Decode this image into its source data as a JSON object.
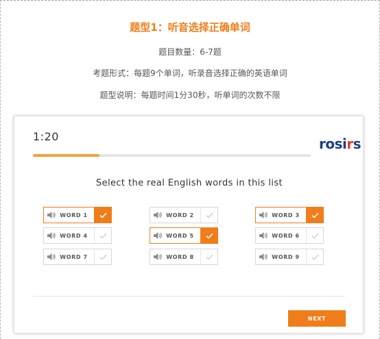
{
  "intro": {
    "title": "题型1：听音选择正确单词",
    "count": "题目数量：6-7题",
    "format": "考题形式：每题9个单词，听录音选择正确的英语单词",
    "description": "题型说明：每题时间1分30秒，听单词的次数不限"
  },
  "quiz": {
    "timer": "1:20",
    "logo_text": "rosi",
    "logo_swoosh": "r",
    "logo_tail": "s",
    "progress": 0.24,
    "instruction": "Select the real English words in this list",
    "words": [
      {
        "label": "WORD 1",
        "selected": true
      },
      {
        "label": "WORD 2",
        "selected": false
      },
      {
        "label": "WORD 3",
        "selected": true
      },
      {
        "label": "WORD 4",
        "selected": false
      },
      {
        "label": "WORD 5",
        "selected": true
      },
      {
        "label": "WORD 6",
        "selected": false
      },
      {
        "label": "WORD 7",
        "selected": false
      },
      {
        "label": "WORD 8",
        "selected": false
      },
      {
        "label": "WORD 9",
        "selected": false
      }
    ],
    "next_label": "NEXT"
  },
  "colors": {
    "accent": "#f07d19",
    "progress": "#f5a13a",
    "logo_blue": "#1b3f84",
    "logo_red": "#e23c2c"
  },
  "icons": {
    "speaker": "speaker-icon",
    "check": "check-icon"
  }
}
